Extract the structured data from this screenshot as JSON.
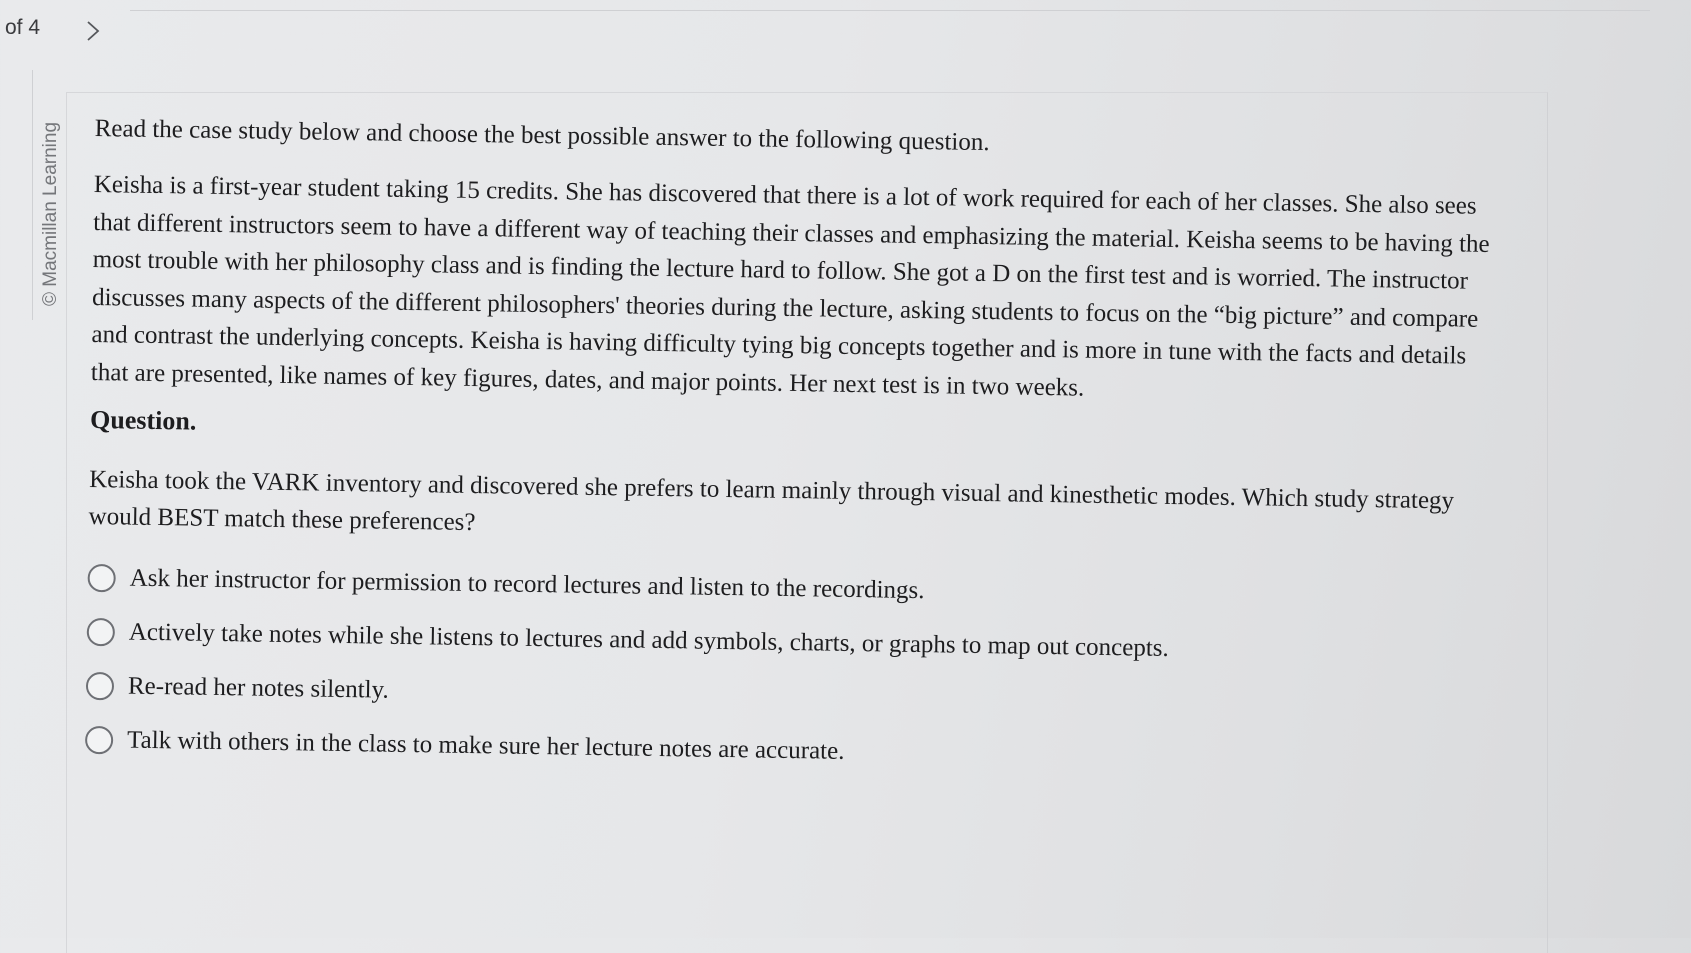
{
  "nav": {
    "page_count": "of 4",
    "next_symbol": ">"
  },
  "sidebar": {
    "copyright": "© Macmillan Learning"
  },
  "content": {
    "intro": "Read the case study below and choose the best possible answer to the following question.",
    "case_study": "Keisha is a first-year student taking 15 credits. She has discovered that there is a lot of work required for each of her classes. She also sees that different instructors seem to have a different way of teaching their classes and emphasizing the material. Keisha seems to be having the most trouble with her philosophy class and is finding the lecture hard to follow. She got a D on the first test and is worried. The instructor discusses many aspects of the different philosophers' theories during the lecture, asking students to focus on the “big picture” and compare and contrast the underlying concepts. Keisha is having difficulty tying big concepts together and is more in tune with the facts and details that are presented, like names of key figures, dates, and major points. Her next test is in two weeks.",
    "question_heading": "Question.",
    "question_text": "Keisha took the VARK inventory and discovered she prefers to learn mainly through visual and kinesthetic modes. Which study strategy would BEST match these preferences?",
    "options": [
      {
        "label": "Ask her instructor for permission to record lectures and listen to the recordings."
      },
      {
        "label": "Actively take notes while she listens to lectures and add symbols, charts, or graphs to map out concepts."
      },
      {
        "label": "Re-read her notes silently."
      },
      {
        "label": "Talk with others in the class to make sure her lecture notes are accurate."
      }
    ]
  }
}
